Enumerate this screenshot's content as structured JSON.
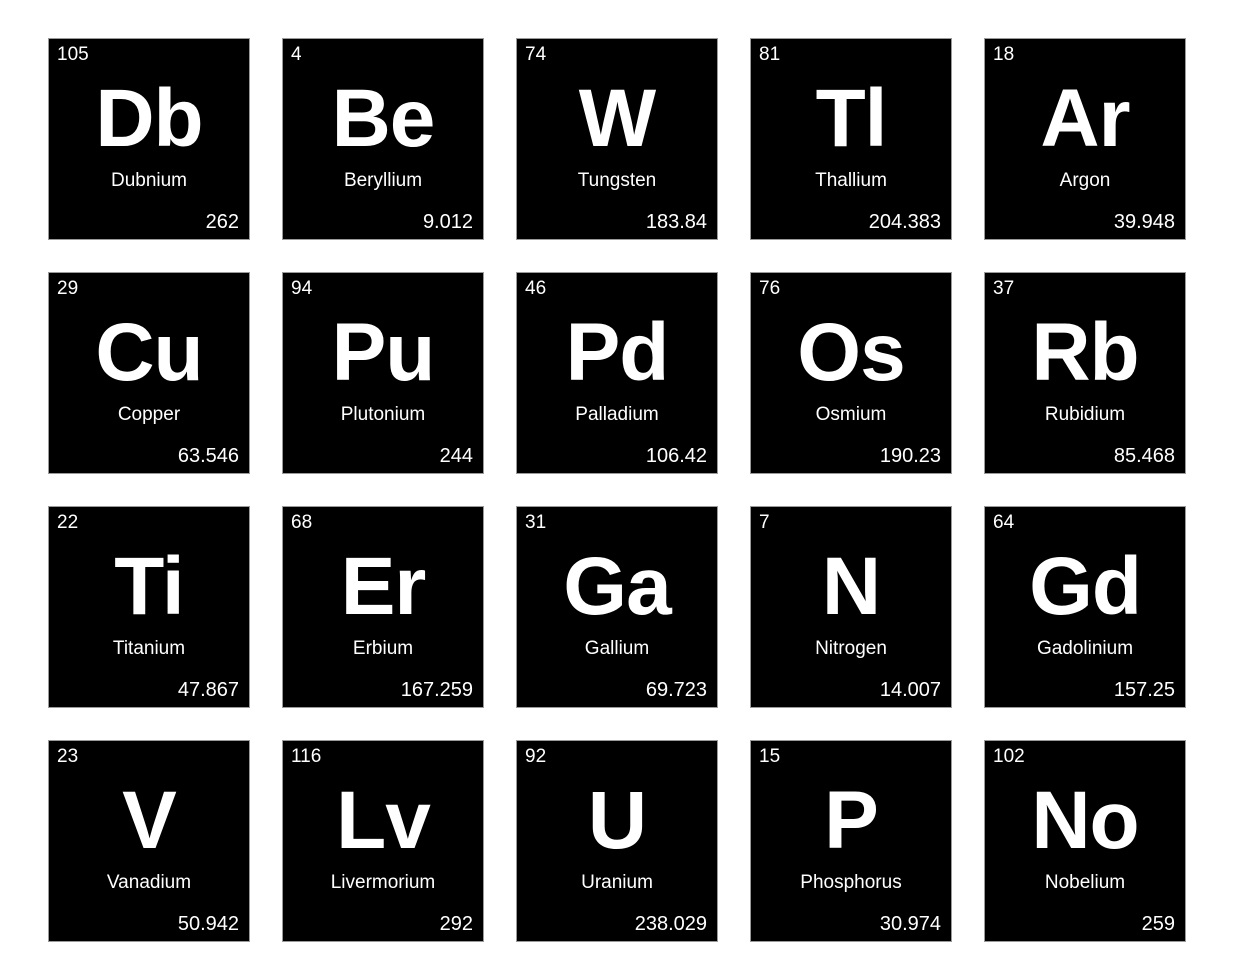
{
  "colors": {
    "page_background": "#ffffff",
    "tile_background": "#000000",
    "tile_text": "#ffffff",
    "tile_border": "#9a9a9a"
  },
  "elements": [
    {
      "number": "105",
      "symbol": "Db",
      "name": "Dubnium",
      "mass": "262"
    },
    {
      "number": "4",
      "symbol": "Be",
      "name": "Beryllium",
      "mass": "9.012"
    },
    {
      "number": "74",
      "symbol": "W",
      "name": "Tungsten",
      "mass": "183.84"
    },
    {
      "number": "81",
      "symbol": "Tl",
      "name": "Thallium",
      "mass": "204.383"
    },
    {
      "number": "18",
      "symbol": "Ar",
      "name": "Argon",
      "mass": "39.948"
    },
    {
      "number": "29",
      "symbol": "Cu",
      "name": "Copper",
      "mass": "63.546"
    },
    {
      "number": "94",
      "symbol": "Pu",
      "name": "Plutonium",
      "mass": "244"
    },
    {
      "number": "46",
      "symbol": "Pd",
      "name": "Palladium",
      "mass": "106.42"
    },
    {
      "number": "76",
      "symbol": "Os",
      "name": "Osmium",
      "mass": "190.23"
    },
    {
      "number": "37",
      "symbol": "Rb",
      "name": "Rubidium",
      "mass": "85.468"
    },
    {
      "number": "22",
      "symbol": "Ti",
      "name": "Titanium",
      "mass": "47.867"
    },
    {
      "number": "68",
      "symbol": "Er",
      "name": "Erbium",
      "mass": "167.259"
    },
    {
      "number": "31",
      "symbol": "Ga",
      "name": "Gallium",
      "mass": "69.723"
    },
    {
      "number": "7",
      "symbol": "N",
      "name": "Nitrogen",
      "mass": "14.007"
    },
    {
      "number": "64",
      "symbol": "Gd",
      "name": "Gadolinium",
      "mass": "157.25"
    },
    {
      "number": "23",
      "symbol": "V",
      "name": "Vanadium",
      "mass": "50.942"
    },
    {
      "number": "116",
      "symbol": "Lv",
      "name": "Livermorium",
      "mass": "292"
    },
    {
      "number": "92",
      "symbol": "U",
      "name": "Uranium",
      "mass": "238.029"
    },
    {
      "number": "15",
      "symbol": "P",
      "name": "Phosphorus",
      "mass": "30.974"
    },
    {
      "number": "102",
      "symbol": "No",
      "name": "Nobelium",
      "mass": "259"
    }
  ]
}
